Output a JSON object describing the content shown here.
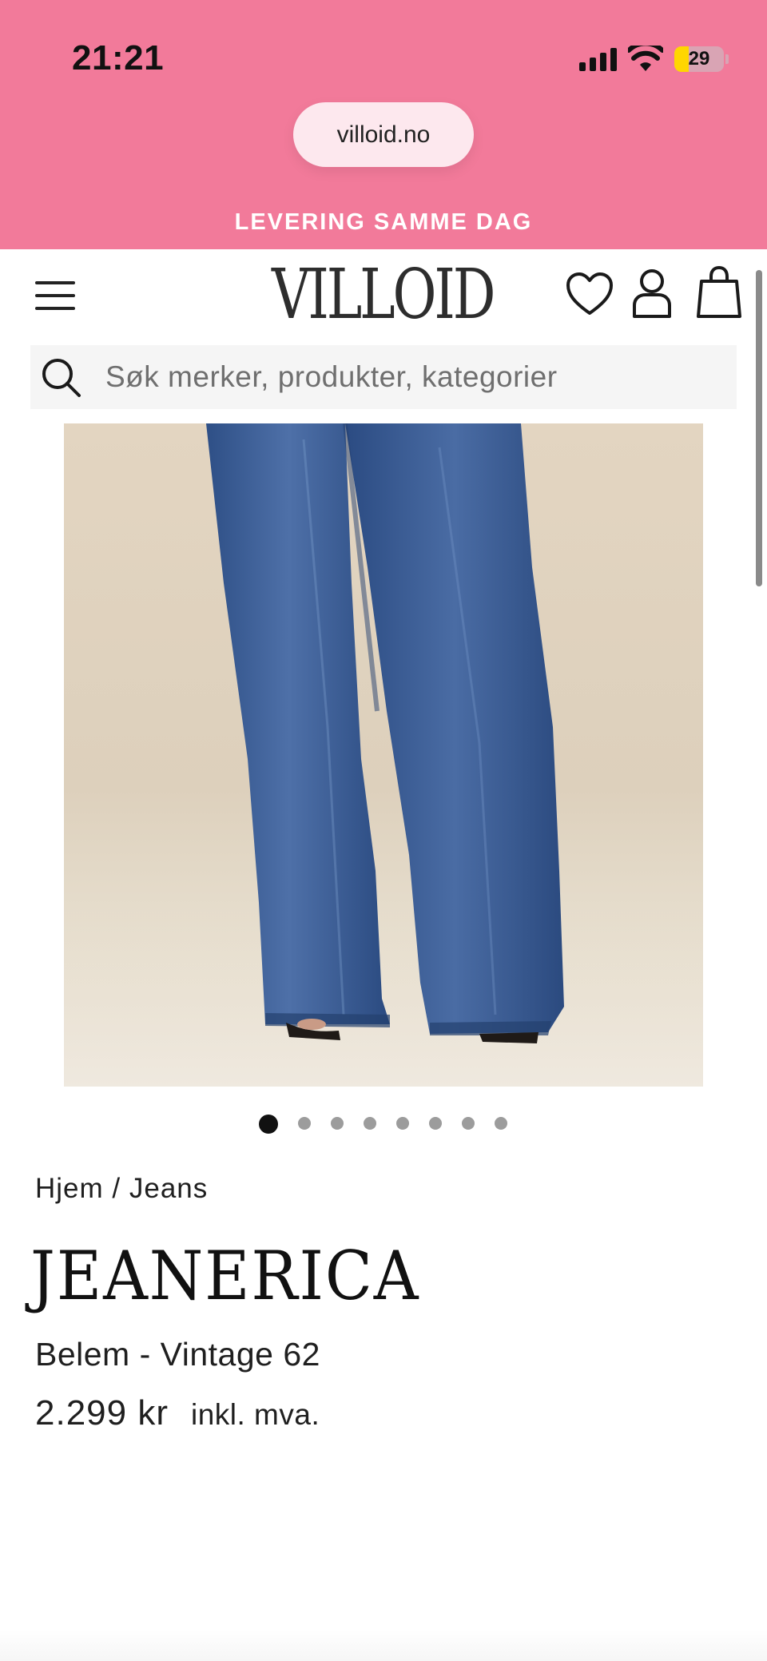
{
  "status_bar": {
    "time": "21:21",
    "battery_level": "29",
    "battery_fraction": 0.29,
    "icons": [
      "cellular-signal-icon",
      "wifi-icon",
      "battery-icon"
    ]
  },
  "browser": {
    "url": "villoid.no"
  },
  "promo_banner": {
    "text": "LEVERING SAMME DAG",
    "background": "#f27a9a"
  },
  "header": {
    "logo": "VILLOID",
    "icons": [
      "menu-icon",
      "heart-icon",
      "user-icon",
      "shopping-bag-icon"
    ]
  },
  "search": {
    "placeholder": "Søk merker, produkter, kategorier"
  },
  "gallery": {
    "image_alt": "Blue wide-leg jeans",
    "total_images": 8,
    "active_index": 0
  },
  "product": {
    "breadcrumb": [
      "Hjem",
      "Jeans"
    ],
    "breadcrumb_separator": "/",
    "brand": "JEANERICA",
    "name": "Belem - Vintage 62",
    "price": "2.299 kr",
    "vat_note": "inkl. mva."
  }
}
